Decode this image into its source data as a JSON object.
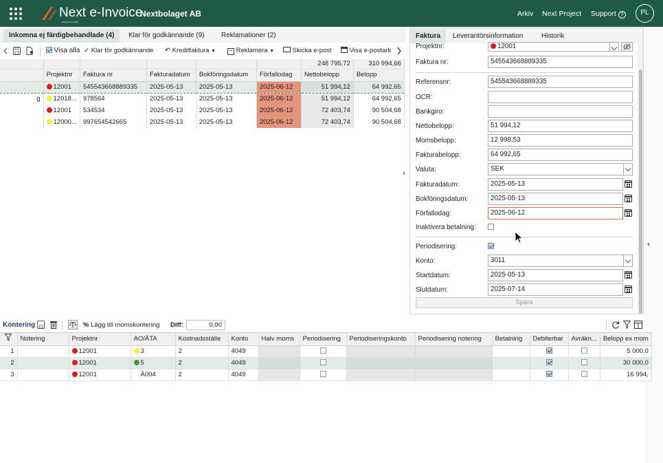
{
  "header": {
    "logo_name": "Next",
    "logo_product": " e-Invoice",
    "logo_sub": "Powered by Azets",
    "company": "Nextbolaget AB",
    "nav": [
      "Arkiv",
      "Next Project",
      "Support"
    ],
    "avatar": "PL",
    "colors": {
      "bar": "#1f5a47",
      "logo_accent": "#e35a33"
    }
  },
  "main_tabs": [
    {
      "label": "Inkomna ej färdigbehandlade (4)",
      "active": true
    },
    {
      "label": "Klar för godkännande (9)",
      "active": false
    },
    {
      "label": "Reklamationer (2)",
      "active": false
    }
  ],
  "toolbar": {
    "show_all": "Visa alla",
    "ready_for_approval": "Klar för godkännande",
    "credit_invoice": "Kreditfaktura",
    "reclaim": "Reklamera",
    "send_email": "Skicka e-post",
    "show_email": "Visa e-postark"
  },
  "invoice_table": {
    "sums": {
      "netto": "248 795,72",
      "belopp": "310 994,66"
    },
    "columns": [
      "",
      "Projektnr",
      "Faktura nr",
      "Fakturadatum",
      "Bokföringsdatum",
      "Förfallodag",
      "Nettobelopp",
      "Belopp"
    ],
    "rows": [
      {
        "lead": "",
        "dot": "red",
        "projekt": "12001",
        "faktura": "545543668889335",
        "fdatum": "2025-05-13",
        "bdatum": "2025-05-13",
        "forfall": "2025-06-12",
        "netto": "51 994,12",
        "belopp": "64 992,65"
      },
      {
        "lead": "g",
        "dot": "yellow",
        "projekt": "12018...",
        "faktura": "978564",
        "fdatum": "2025-05-13",
        "bdatum": "2025-05-13",
        "forfall": "2025-06-12",
        "netto": "51 994,12",
        "belopp": "64 992,65"
      },
      {
        "lead": "",
        "dot": "red",
        "projekt": "12001",
        "faktura": "534534",
        "fdatum": "2025-05-13",
        "bdatum": "2025-05-13",
        "forfall": "2025-06-12",
        "netto": "72 403,74",
        "belopp": "90 504,68"
      },
      {
        "lead": "",
        "dot": "yellow",
        "projekt": "12000...",
        "faktura": "997654542665",
        "fdatum": "2025-05-13",
        "bdatum": "2025-05-13",
        "forfall": "2025-06-12",
        "netto": "72 403,74",
        "belopp": "90 504,68"
      }
    ]
  },
  "right_panel": {
    "tabs": [
      {
        "label": "Faktura",
        "active": true
      },
      {
        "label": "Leverantörsinformation",
        "active": false
      },
      {
        "label": "Historik",
        "active": false
      }
    ],
    "fields": {
      "projektnr_label": "Projektnr:",
      "projektnr": "12001",
      "fakturanr_label": "Faktura nr:",
      "fakturanr": "545543668889335",
      "referensnr_label": "Referensnr:",
      "referensnr": "545543668889335",
      "ocr_label": "OCR:",
      "ocr": "",
      "bankgiro_label": "Bankgiro:",
      "bankgiro": "",
      "nettobelopp_label": "Nettobelopp:",
      "nettobelopp": "51 994,12",
      "momsbelopp_label": "Momsbelopp:",
      "momsbelopp": "12 998,53",
      "fakturabelopp_label": "Fakturabelopp:",
      "fakturabelopp": "64 992,65",
      "valuta_label": "Valuta:",
      "valuta": "SEK",
      "fakturadatum_label": "Fakturadatum:",
      "fakturadatum": "2025-05-13",
      "bokforingsdatum_label": "Bokföringsdatum:",
      "bokforingsdatum": "2025-05-13",
      "forfallodag_label": "Förfallodag:",
      "forfallodag": "2025-06-12",
      "inaktivera_label": "Inaktivera betalning:",
      "periodisering_label": "Periodisering:",
      "konto_label": "Konto:",
      "konto": "3011",
      "startdatum_label": "Startdatum:",
      "startdatum": "2025-05-13",
      "slutdatum_label": "Slutdatum:",
      "slutdatum": "2025-07-14"
    },
    "save": "Spara"
  },
  "kontering": {
    "title": "Kontering",
    "add_vat": "Lägg till momskontering",
    "diff_label": "Diff:",
    "diff_value": "0,00",
    "columns": [
      "",
      "Notering",
      "Projektnr",
      "AO/ÄTA",
      "Kostnadsställe",
      "Konto",
      "Halv moms",
      "Periodisering",
      "Periodiseringskonto",
      "Periodisering notering",
      "Betalning",
      "Debiterbar",
      "Avräkn...",
      "Belopp ex mom"
    ],
    "rows": [
      {
        "nr": "1",
        "dot": "red",
        "projekt": "12001",
        "ao_dot": "yellow",
        "ao": "3",
        "kst": "2",
        "konto": "4049",
        "debiterbar": true,
        "belopp": "5 000,0"
      },
      {
        "nr": "2",
        "dot": "red",
        "projekt": "12001",
        "ao_dot": "green",
        "ao": "5",
        "kst": "2",
        "konto": "4049",
        "debiterbar": true,
        "belopp": "30 000,0"
      },
      {
        "nr": "3",
        "dot": "red",
        "projekt": "12001",
        "ao_dot": "",
        "ao": "Ä004",
        "kst": "2",
        "konto": "4049",
        "debiterbar": true,
        "belopp": "16 994,"
      }
    ]
  }
}
